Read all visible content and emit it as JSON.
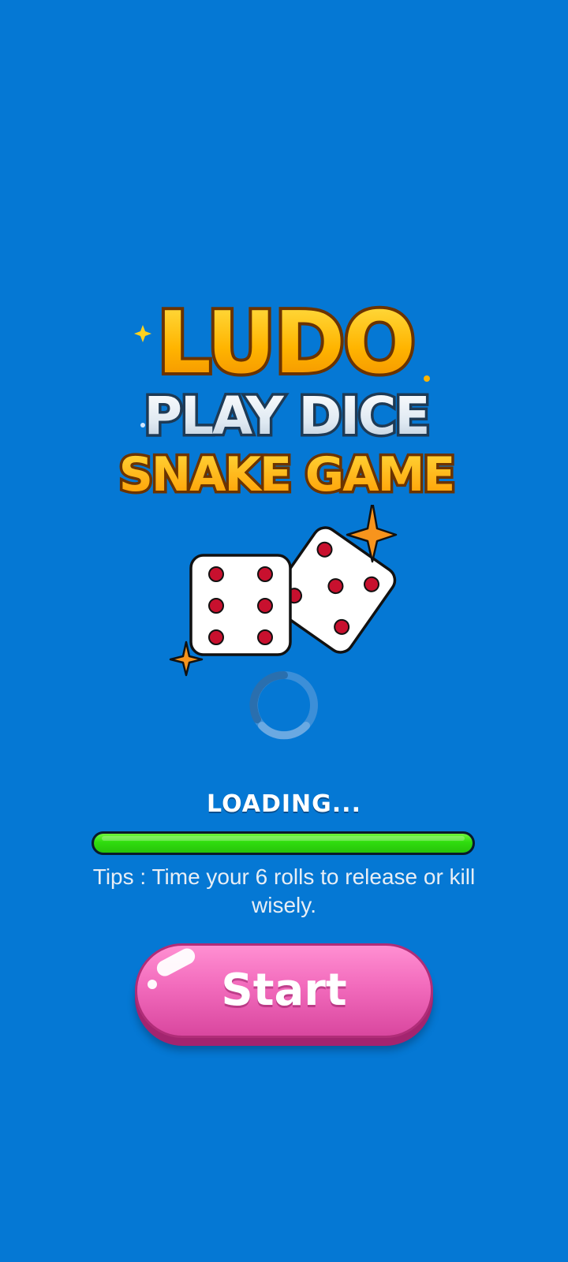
{
  "logo": {
    "line1": "LUDO",
    "line2": "PLAY DICE",
    "line3": "SNAKE GAME"
  },
  "loading": {
    "label": "LOADING...",
    "progress": 1.0
  },
  "tip": {
    "text": "Tips : Time your 6 rolls to release or kill wisely."
  },
  "start_button": {
    "label": "Start"
  },
  "colors": {
    "background": "#0578d4",
    "logo_gold": "#ffb400",
    "logo_silver": "#dfe9f2",
    "progress_green": "#2fdc0e",
    "button_pink": "#f26bbc",
    "die_pip": "#c8102e",
    "sparkle_orange": "#f7941d"
  },
  "icons": {
    "dice": "dice-pair-icon",
    "spinner": "loading-spinner-icon",
    "sparkles": "sparkle-icon"
  }
}
